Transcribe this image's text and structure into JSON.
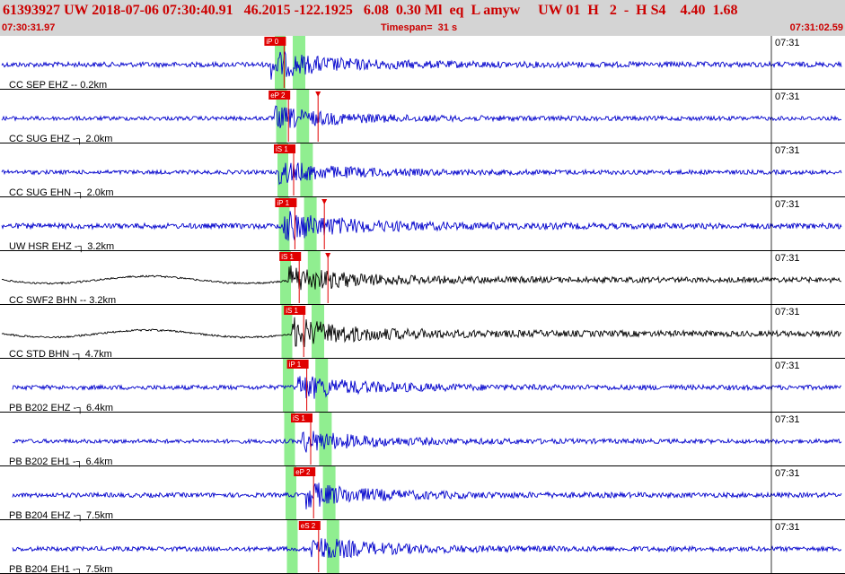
{
  "header": {
    "title": "61393927 UW 2018-07-06 07:30:40.91   46.2015 -122.1925   6.08  0.30 Ml  eq  L amyw     UW 01  H   2  -  H S4    4.40  1.68",
    "start_time": "07:30:31.97",
    "timespan": "Timespan=  31 s",
    "end_time": "07:31:02.59"
  },
  "colors": {
    "header_bg": "#d4d4d4",
    "header_text": "#cc0000",
    "trace_blue": "#0000cc",
    "trace_black": "#000000",
    "pick_red": "#e00000",
    "window_green": "#90ee90",
    "grid": "#000000"
  },
  "minute_tick_label": "07:31",
  "traces": [
    {
      "station": "CC SEP EHZ -- 0.2km",
      "color": "blue",
      "amplitude": 0.55,
      "picks": [
        {
          "label": "iP 0",
          "time": 7.2
        }
      ]
    },
    {
      "station": "CC SUG EHZ -┐ 2.0km",
      "color": "blue",
      "amplitude": 0.45,
      "picks": [
        {
          "label": "eP 2",
          "time": 7.6
        },
        {
          "label": "",
          "time": 9.1,
          "marker": true
        }
      ]
    },
    {
      "station": "CC SUG EHN -┐ 2.0km",
      "color": "blue",
      "amplitude": 0.45,
      "picks": [
        {
          "label": "iS 1",
          "time": 8.5
        }
      ]
    },
    {
      "station": "UW HSR EHZ -┐ 3.2km",
      "color": "blue",
      "amplitude": 0.6,
      "picks": [
        {
          "label": "iP 1",
          "time": 7.2
        },
        {
          "label": "",
          "time": 8.6,
          "marker": true
        }
      ]
    },
    {
      "station": "CC SWF2 BHN -- 3.2km",
      "color": "black",
      "amplitude": 0.55,
      "picks": [
        {
          "label": "iS 1",
          "time": 7.6
        },
        {
          "label": "",
          "time": 8.6,
          "marker": true
        }
      ]
    },
    {
      "station": "CC STD BHN -┐ 4.7km",
      "color": "black",
      "amplitude": 0.6,
      "picks": [
        {
          "label": "iS 1",
          "time": 8.1
        }
      ]
    },
    {
      "station": "PB B202 EHZ -┐ 6.4km",
      "color": "blue",
      "amplitude": 0.5,
      "picks": [
        {
          "label": "iP 1",
          "time": 7.8
        }
      ]
    },
    {
      "station": "PB B202 EH1 -┐ 6.4km",
      "color": "blue",
      "amplitude": 0.45,
      "picks": [
        {
          "label": "iS 1",
          "time": 8.0
        }
      ]
    },
    {
      "station": "PB B204 EHZ -┐ 7.5km",
      "color": "blue",
      "amplitude": 0.5,
      "picks": [
        {
          "label": "eP 2",
          "time": 7.6
        }
      ]
    },
    {
      "station": "PB B204 EH1 -┐ 7.5km",
      "color": "blue",
      "amplitude": 0.5,
      "picks": [
        {
          "label": "eS 2",
          "time": 8.4
        }
      ]
    }
  ]
}
